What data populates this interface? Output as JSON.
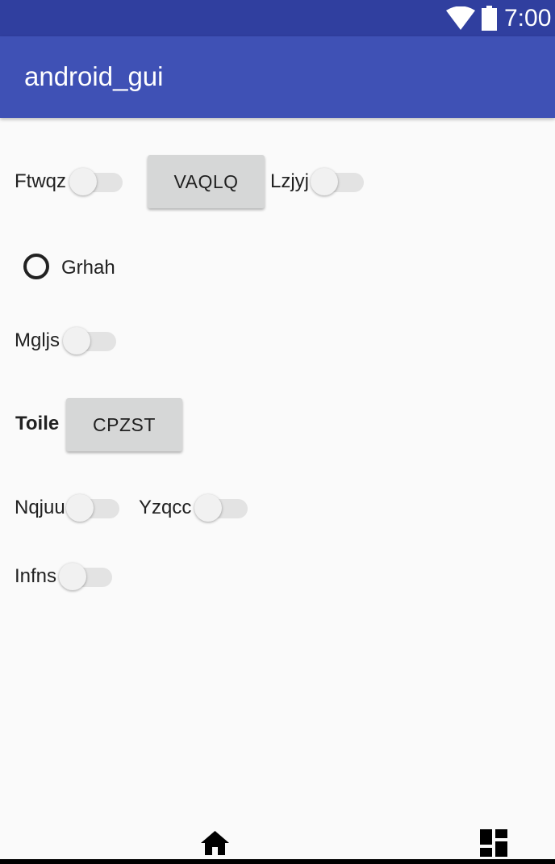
{
  "status_bar": {
    "time": "7:00",
    "icons": [
      "wifi-icon",
      "battery-icon"
    ]
  },
  "app_bar": {
    "title": "android_gui"
  },
  "row1": {
    "switch1_label": "Ftwqz",
    "button_label": "VAQLQ",
    "switch2_label": "Lzjyj"
  },
  "row2": {
    "radio_label": "Grhah",
    "radio_checked": false
  },
  "row3": {
    "switch_label": "Mgljs"
  },
  "row4": {
    "label": "Toile",
    "button_label": "CPZST"
  },
  "row5": {
    "switch1_label": "Nqjuu",
    "switch2_label": "Yzqcc"
  },
  "row6": {
    "switch_label": "Infns"
  },
  "switch_states": {
    "Ftwqz": false,
    "Lzjyj": false,
    "Mgljs": false,
    "Nqjuu": false,
    "Yzqcc": false,
    "Infns": false
  },
  "bottom_icons": [
    "home-icon",
    "dashboard-icon"
  ],
  "colors": {
    "status_bar": "#303f9f",
    "app_bar": "#3f51b5",
    "background": "#fafafa",
    "button": "#d6d7d7"
  }
}
